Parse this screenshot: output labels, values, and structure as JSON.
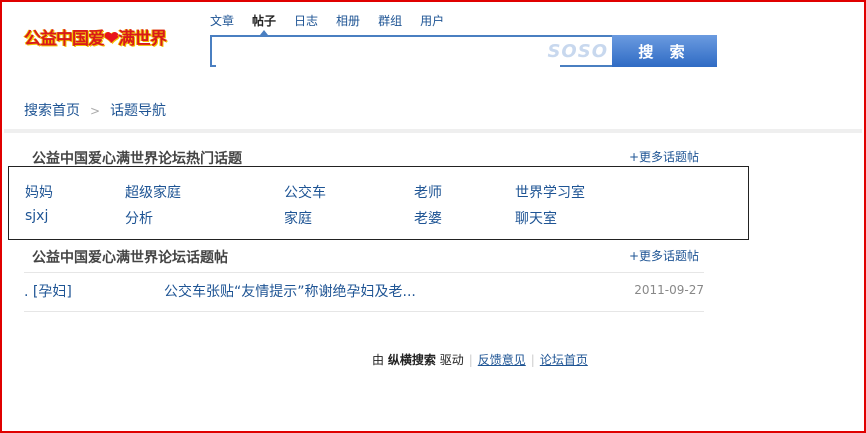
{
  "logo": {
    "text_a": "公益中国爱",
    "heart": "❤",
    "text_b": "满世界"
  },
  "tabs": [
    "文章",
    "帖子",
    "日志",
    "相册",
    "群组",
    "用户"
  ],
  "search": {
    "value": "",
    "placeholder": "",
    "brand": "SOSO",
    "button_label": "搜 索"
  },
  "breadcrumb": {
    "home": "搜索首页",
    "separator": ">",
    "current": "话题导航"
  },
  "hot_topics": {
    "title": "公益中国爱心满世界论坛热门话题",
    "more": "+更多话题帖",
    "items": [
      "妈妈",
      "超级家庭",
      "公交车",
      "老师",
      "世界学习室",
      "sjxj",
      "分析",
      "家庭",
      "老婆",
      "聊天室"
    ]
  },
  "topic_posts": {
    "title": "公益中国爱心满世界论坛话题帖",
    "more": "+更多话题帖",
    "rows": [
      {
        "tag": ". [孕妇]",
        "title": "公交车张贴“友情提示”称谢绝孕妇及老...",
        "date": "2011-09-27"
      }
    ]
  },
  "footer": {
    "by": "由",
    "engine": "纵横搜索",
    "powered": "驱动",
    "feedback": "反馈意见",
    "separator": "|",
    "forum_home": "论坛首页"
  }
}
